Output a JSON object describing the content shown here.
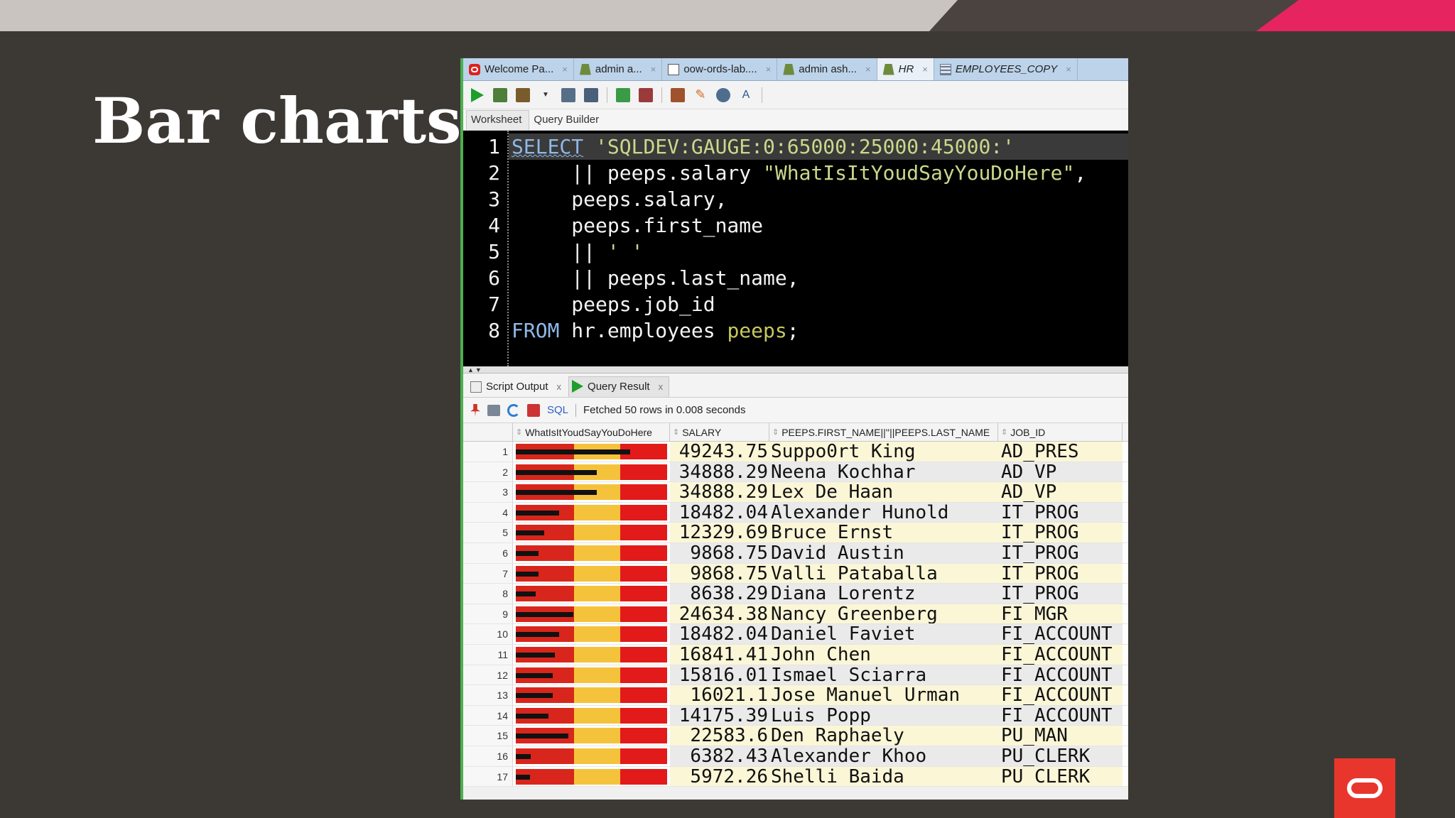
{
  "slide": {
    "title": "Bar charts"
  },
  "tabs": [
    {
      "label": "Welcome Pa...",
      "icon": "oracle-welcome-icon"
    },
    {
      "label": "admin a...",
      "icon": "sql-connection-icon"
    },
    {
      "label": "oow-ords-lab....",
      "icon": "file-icon"
    },
    {
      "label": "admin ash...",
      "icon": "sql-connection-icon"
    },
    {
      "label": "HR",
      "icon": "sql-connection-icon",
      "active": true
    },
    {
      "label": "EMPLOYEES_COPY",
      "icon": "table-icon"
    }
  ],
  "tab_close": "×",
  "subtabs": {
    "worksheet": "Worksheet",
    "query_builder": "Query Builder"
  },
  "editor": {
    "line_numbers": [
      "1",
      "2",
      "3",
      "4",
      "5",
      "6",
      "7",
      "8"
    ]
  },
  "result_tabs": {
    "script_output": "Script Output",
    "query_result": "Query Result",
    "close": "x"
  },
  "result_toolbar": {
    "sql_label": "SQL",
    "status": "Fetched 50 rows in 0.008 seconds"
  },
  "grid": {
    "headers": [
      "WhatIsItYoudSayYouDoHere",
      "SALARY",
      "PEEPS.FIRST_NAME||''||PEEPS.LAST_NAME",
      "JOB_ID"
    ],
    "gauge": {
      "min": 0,
      "max": 65000,
      "low": 25000,
      "high": 45000,
      "colors": {
        "low": "#d8261c",
        "mid": "#f5c33b",
        "high": "#e21a1a"
      }
    },
    "rows": [
      {
        "n": "1",
        "salary": "49243.75",
        "value": 49243.75,
        "name": "Suppo0rt King",
        "job": "AD_PRES"
      },
      {
        "n": "2",
        "salary": "34888.29",
        "value": 34888.29,
        "name": "Neena Kochhar",
        "job": "AD_VP"
      },
      {
        "n": "3",
        "salary": "34888.29",
        "value": 34888.29,
        "name": "Lex De Haan",
        "job": "AD_VP"
      },
      {
        "n": "4",
        "salary": "18482.04",
        "value": 18482.04,
        "name": "Alexander Hunold",
        "job": "IT_PROG"
      },
      {
        "n": "5",
        "salary": "12329.69",
        "value": 12329.69,
        "name": "Bruce Ernst",
        "job": "IT_PROG"
      },
      {
        "n": "6",
        "salary": "9868.75",
        "value": 9868.75,
        "name": "David Austin",
        "job": "IT_PROG"
      },
      {
        "n": "7",
        "salary": "9868.75",
        "value": 9868.75,
        "name": "Valli Pataballa",
        "job": "IT_PROG"
      },
      {
        "n": "8",
        "salary": "8638.29",
        "value": 8638.29,
        "name": "Diana Lorentz",
        "job": "IT_PROG"
      },
      {
        "n": "9",
        "salary": "24634.38",
        "value": 24634.38,
        "name": "Nancy Greenberg",
        "job": "FI_MGR"
      },
      {
        "n": "10",
        "salary": "18482.04",
        "value": 18482.04,
        "name": "Daniel Faviet",
        "job": "FI_ACCOUNT"
      },
      {
        "n": "11",
        "salary": "16841.41",
        "value": 16841.41,
        "name": "John Chen",
        "job": "FI_ACCOUNT"
      },
      {
        "n": "12",
        "salary": "15816.01",
        "value": 15816.01,
        "name": "Ismael Sciarra",
        "job": "FI_ACCOUNT"
      },
      {
        "n": "13",
        "salary": "16021.1",
        "value": 16021.1,
        "name": "Jose Manuel Urman",
        "job": "FI_ACCOUNT"
      },
      {
        "n": "14",
        "salary": "14175.39",
        "value": 14175.39,
        "name": "Luis Popp",
        "job": "FI_ACCOUNT"
      },
      {
        "n": "15",
        "salary": "22583.6",
        "value": 22583.6,
        "name": "Den Raphaely",
        "job": "PU_MAN"
      },
      {
        "n": "16",
        "salary": "6382.43",
        "value": 6382.43,
        "name": "Alexander Khoo",
        "job": "PU_CLERK"
      },
      {
        "n": "17",
        "salary": "5972.26",
        "value": 5972.26,
        "name": "Shelli Baida",
        "job": "PU_CLERK"
      }
    ]
  }
}
